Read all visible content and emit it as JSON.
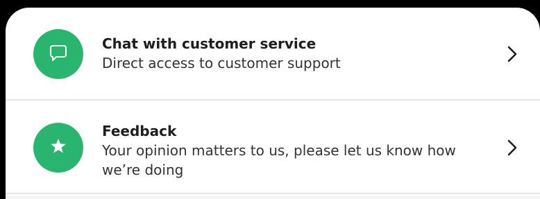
{
  "colors": {
    "accent": "#2ab56f",
    "background": "#000000",
    "sheet": "#ffffff",
    "divider": "#e6e6e6"
  },
  "menu": {
    "items": [
      {
        "icon": "chat-bubble-icon",
        "title": "Chat with customer service",
        "subtitle": "Direct access to customer support",
        "trailing_icon": "chevron-right-icon"
      },
      {
        "icon": "star-icon",
        "title": "Feedback",
        "subtitle": "Your opinion matters to us, please let us know how we’re doing",
        "trailing_icon": "chevron-right-icon"
      }
    ]
  }
}
